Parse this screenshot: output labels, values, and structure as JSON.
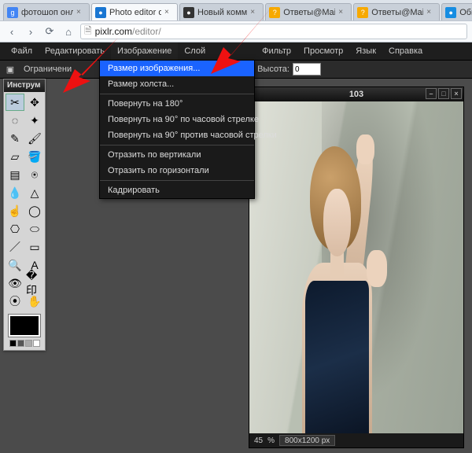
{
  "browser": {
    "tabs": [
      {
        "title": "фотошоп онл",
        "fav_bg": "#4285f4",
        "fav_text": "g"
      },
      {
        "title": "Photo editor on",
        "fav_bg": "#1976d2",
        "fav_text": "●",
        "active": true
      },
      {
        "title": "Новый комм",
        "fav_bg": "#333333",
        "fav_text": "●"
      },
      {
        "title": "Ответы@Mail",
        "fav_bg": "#f7a900",
        "fav_text": "?"
      },
      {
        "title": "Ответы@Mail",
        "fav_bg": "#f7a900",
        "fav_text": "?"
      },
      {
        "title": "Общий ф",
        "fav_bg": "#168de2",
        "fav_text": "●"
      }
    ],
    "url_host": "pixlr.com",
    "url_path": "/editor/",
    "nav": {
      "back": "‹",
      "fwd": "›",
      "reload": "⟳",
      "home": "⌂",
      "doc": "🗎"
    }
  },
  "menubar": {
    "items": [
      "Файл",
      "Редактировать",
      "Изображение",
      "Слой",
      "",
      "",
      "Фильтр",
      "Просмотр",
      "Язык",
      "Справка"
    ]
  },
  "optbar": {
    "crop_icon": "▣",
    "constraint_label": "Ограничени",
    "constraint_value": "",
    "width_value": "",
    "height_label": "Высота:",
    "height_value": "0"
  },
  "toolbox": {
    "title": "Инструм",
    "tools": [
      "crop",
      "move",
      "lasso",
      "wand",
      "pencil",
      "brush",
      "eraser",
      "paint",
      "grad",
      "clone",
      "blur",
      "sharp",
      "smudge",
      "sponge",
      "drop",
      "shape",
      "line",
      "rect",
      "zoom",
      "text",
      "red",
      "stamp",
      "pick",
      "hand"
    ],
    "icons": {
      "crop": "✂",
      "move": "✥",
      "lasso": "◌",
      "wand": "✦",
      "pencil": "✎",
      "brush": "🖌",
      "eraser": "▱",
      "paint": "🪣",
      "grad": "▤",
      "clone": "⍟",
      "blur": "💧",
      "sharp": "△",
      "smudge": "☝",
      "sponge": "◯",
      "drop": "⎔",
      "shape": "⬭",
      "line": "／",
      "rect": "▭",
      "zoom": "🔍",
      "text": "A",
      "red": "👁",
      "stamp": "�印",
      "pick": "⦿",
      "hand": "✋"
    }
  },
  "dropdown": {
    "items": [
      {
        "label": "Размер изображения...",
        "hl": true
      },
      {
        "label": "Размер холста..."
      },
      {
        "sep": true
      },
      {
        "label": "Повернуть на 180°"
      },
      {
        "label": "Повернуть на 90° по часовой стрелке"
      },
      {
        "label": "Повернуть на 90° против часовой стрелки"
      },
      {
        "sep": true
      },
      {
        "label": "Отразить по вертикали"
      },
      {
        "label": "Отразить по горизонтали"
      },
      {
        "sep": true
      },
      {
        "label": "Кадрировать"
      }
    ]
  },
  "canvas": {
    "title": "103",
    "zoom": "45",
    "pct": "%",
    "dims": "800x1200 px"
  },
  "colors": {
    "accent": "#1a63ff",
    "arrow": "#e11",
    "bg_dark": "#1e1e1e"
  }
}
